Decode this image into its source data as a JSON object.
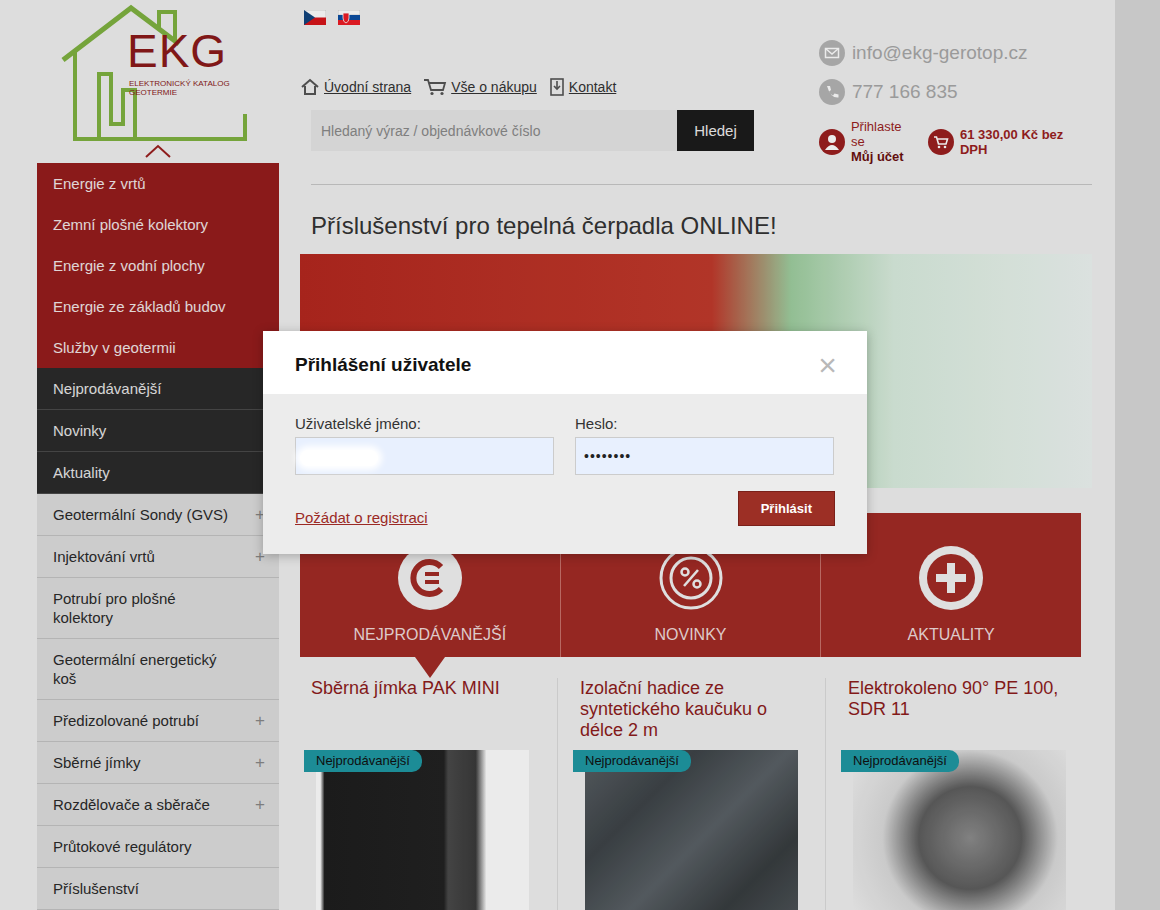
{
  "logo": {
    "title": "EKG",
    "subtitle": [
      "ELEKTRONICKÝ KATALOG",
      "GEOTERMIE"
    ]
  },
  "nav": [
    {
      "label": "Úvodní strana"
    },
    {
      "label": "Vše o nákupu"
    },
    {
      "label": "Kontakt"
    }
  ],
  "search": {
    "placeholder": "Hledaný výraz / objednávkové číslo",
    "button": "Hledej"
  },
  "contact": {
    "email": "info@ekg-gerotop.cz",
    "phone": "777 166 835"
  },
  "account": {
    "line1": "Přihlaste se",
    "line2": "Můj účet"
  },
  "cart": {
    "total": "61 330,00 Kč bez DPH"
  },
  "sidebar": {
    "items": [
      {
        "label": "Energie z vrtů",
        "kind": "category",
        "expandable": false
      },
      {
        "label": "Zemní plošné kolektory",
        "kind": "category",
        "expandable": false
      },
      {
        "label": "Energie z vodní plochy",
        "kind": "category",
        "expandable": false
      },
      {
        "label": "Energie ze základů budov",
        "kind": "category",
        "expandable": false
      },
      {
        "label": "Služby v geotermii",
        "kind": "category",
        "expandable": false
      },
      {
        "label": "Nejprodávanější",
        "kind": "section",
        "expandable": false
      },
      {
        "label": "Novinky",
        "kind": "section",
        "expandable": false
      },
      {
        "label": "Aktuality",
        "kind": "section",
        "expandable": false
      },
      {
        "label": "Geotermální Sondy (GVS)",
        "kind": "product",
        "expandable": true,
        "expander": "+"
      },
      {
        "label": "Injektování vrtů",
        "kind": "product",
        "expandable": true,
        "expander": "+"
      },
      {
        "label": "Potrubí pro plošné kolektory",
        "kind": "product",
        "expandable": false
      },
      {
        "label": "Geotermální energetický koš",
        "kind": "product",
        "expandable": false
      },
      {
        "label": "Předizolované potrubí",
        "kind": "product",
        "expandable": true,
        "expander": "+"
      },
      {
        "label": "Sběrné jímky",
        "kind": "product",
        "expandable": true,
        "expander": "+"
      },
      {
        "label": "Rozdělovače a sběrače",
        "kind": "product",
        "expandable": true,
        "expander": "+"
      },
      {
        "label": "Průtokové regulátory",
        "kind": "product",
        "expandable": false
      },
      {
        "label": "Příslušenství",
        "kind": "product",
        "expandable": false
      }
    ]
  },
  "heading": "Příslušenství pro tepelná čerpadla ONLINE!",
  "tiles": [
    {
      "label": "NEJPRODÁVANĚJŠÍ",
      "selected": true
    },
    {
      "label": "NOVINKY",
      "selected": false
    },
    {
      "label": "AKTUALITY",
      "selected": false
    }
  ],
  "products": [
    {
      "name": "Sběrná jímka PAK MINI",
      "badge": "Nejprodávanější"
    },
    {
      "name": "Izolační hadice ze syntetického kaučuku o délce 2 m",
      "badge": "Nejprodávanější"
    },
    {
      "name": "Elektrokoleno 90° PE 100, SDR 11",
      "badge": "Nejprodávanější"
    }
  ],
  "login": {
    "title": "Přihlášení uživatele",
    "close": "×",
    "fields": [
      {
        "label": "Uživatelské jméno:",
        "redacted": true
      },
      {
        "label": "Heslo:",
        "value": "••••••••",
        "redacted": false
      }
    ],
    "register": "Požádat o registraci",
    "submit": "Přihlásit"
  }
}
